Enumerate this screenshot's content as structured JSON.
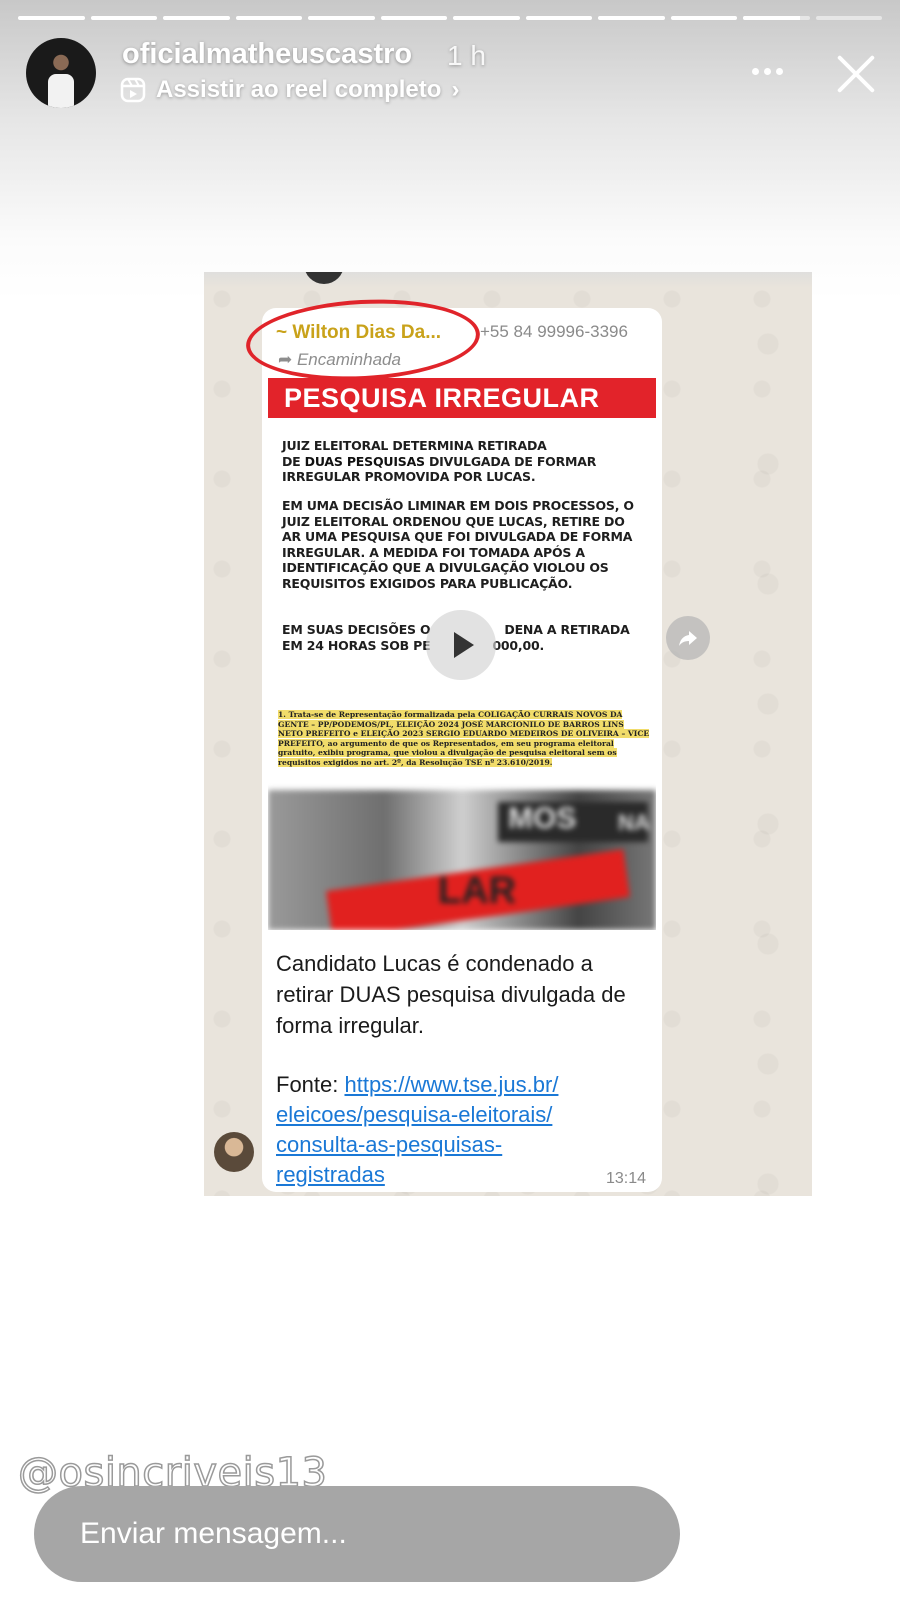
{
  "story": {
    "progress_segments": 12,
    "active_segment_fraction": 0.85,
    "completed_segments": 10
  },
  "header": {
    "username": "oficialmatheuscastro",
    "time_ago": "1 h",
    "reel_link_label": "Assistir ao reel completo",
    "reel_chevron": "›",
    "more_icon": "more-horizontal-icon",
    "close_icon": "close-icon"
  },
  "chat_screenshot": {
    "sender_name": "~ Wilton Dias Da...",
    "sender_phone": "+55 84 99996-3396",
    "forwarded_label": "Encaminhada",
    "banner_title": "PESQUISA IRREGULAR",
    "paragraph1_a": "JUIZ ELEITORAL DETERMINA RETIRADA",
    "paragraph1_b_bold": "DUAS PESQUISAS",
    "paragraph1_b_prefix": "DE ",
    "paragraph1_b_suffix": " DIVULGADA DE FORMAR",
    "paragraph1_c": "IRREGULAR PROMOVIDA POR LUCAS.",
    "paragraph2": "EM UMA DECISÃO LIMINAR EM DOIS PROCESSOS, O JUIZ ELEITORAL ORDENOU QUE LUCAS, RETIRE DO AR UMA PESQUISA QUE FOI DIVULGADA DE FORMA IRREGULAR. A MEDIDA FOI TOMADA APÓS A IDENTIFICAÇÃO QUE A DIVULGAÇÃO VIOLOU OS REQUISITOS EXIGIDOS PARA PUBLICAÇÃO.",
    "paragraph3_a": "EM SUAS DECISÕES O",
    "paragraph3_b": "DENA A RETIRADA",
    "paragraph3_c": "EM 24 HORAS SOB PE",
    "paragraph3_d": "000,00.",
    "fine_print_1": "1. Trata-se de Representação formalizada pela COLIGAÇÃO CURRAIS NOVOS DA GENTE – PP/PODEMOS/PL, ELEIÇÃO 2024 JOSÉ MARCIONILO DE BARROS LINS NETO PREFEITO e ELEIÇÃO 2023 SERGIO EDUARDO MEDEIROS DE OLIVEIRA – VICE PREFEITO, ao argumento de que os Representados, em seu programa eleitoral gratuito, exibiu programa, que violou a divulgação de pesquisa eleitoral sem os requisitos exigidos no art. 2º, da Resolução TSE nº 23.610/2019.",
    "blurred_overlay_word_1": "MOS",
    "blurred_overlay_word_2": "NA",
    "blurred_overlay_word_3": "LAR",
    "caption": "Candidato Lucas é condenado a retirar DUAS pesquisa divulgada de forma irregular.",
    "source_label": "Fonte: ",
    "source_link": "https://www.tse.jus.br/eleicoes/pesquisa-eleitorais/consulta-as-pesquisas-registradas",
    "source_link_line1": "https://www.tse.jus.br/",
    "source_link_line2": "eleicoes/pesquisa-eleitorais/",
    "source_link_line3": "consulta-as-pesquisas-",
    "source_link_line4": "registradas",
    "timestamp": "13:14"
  },
  "watermark": "@osincriveis13",
  "footer": {
    "message_placeholder": "Enviar mensagem..."
  },
  "colors": {
    "banner_red": "#e2232a",
    "circle_red": "#e0242a",
    "link_blue": "#1a78d6",
    "sender_gold": "#c9a21a",
    "input_gray": "#a6a6a6"
  }
}
